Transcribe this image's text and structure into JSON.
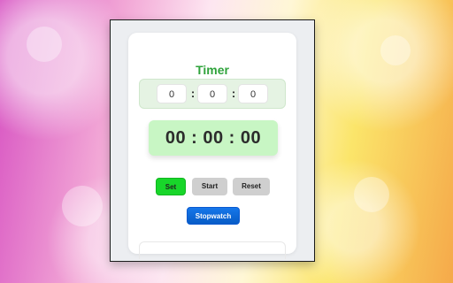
{
  "timer": {
    "title": "Timer",
    "inputs": {
      "hours": "0",
      "minutes": "0",
      "seconds": "0",
      "separator_1": ":",
      "separator_2": ":"
    },
    "display": "00 : 00 : 00",
    "buttons": {
      "set": "Set",
      "start": "Start",
      "reset": "Reset",
      "stopwatch": "Stopwatch"
    }
  },
  "colors": {
    "title": "#2fa33b",
    "set_button": "#18d62a",
    "stopwatch_button": "#1677ea",
    "display_background": "#c8f6c4"
  }
}
